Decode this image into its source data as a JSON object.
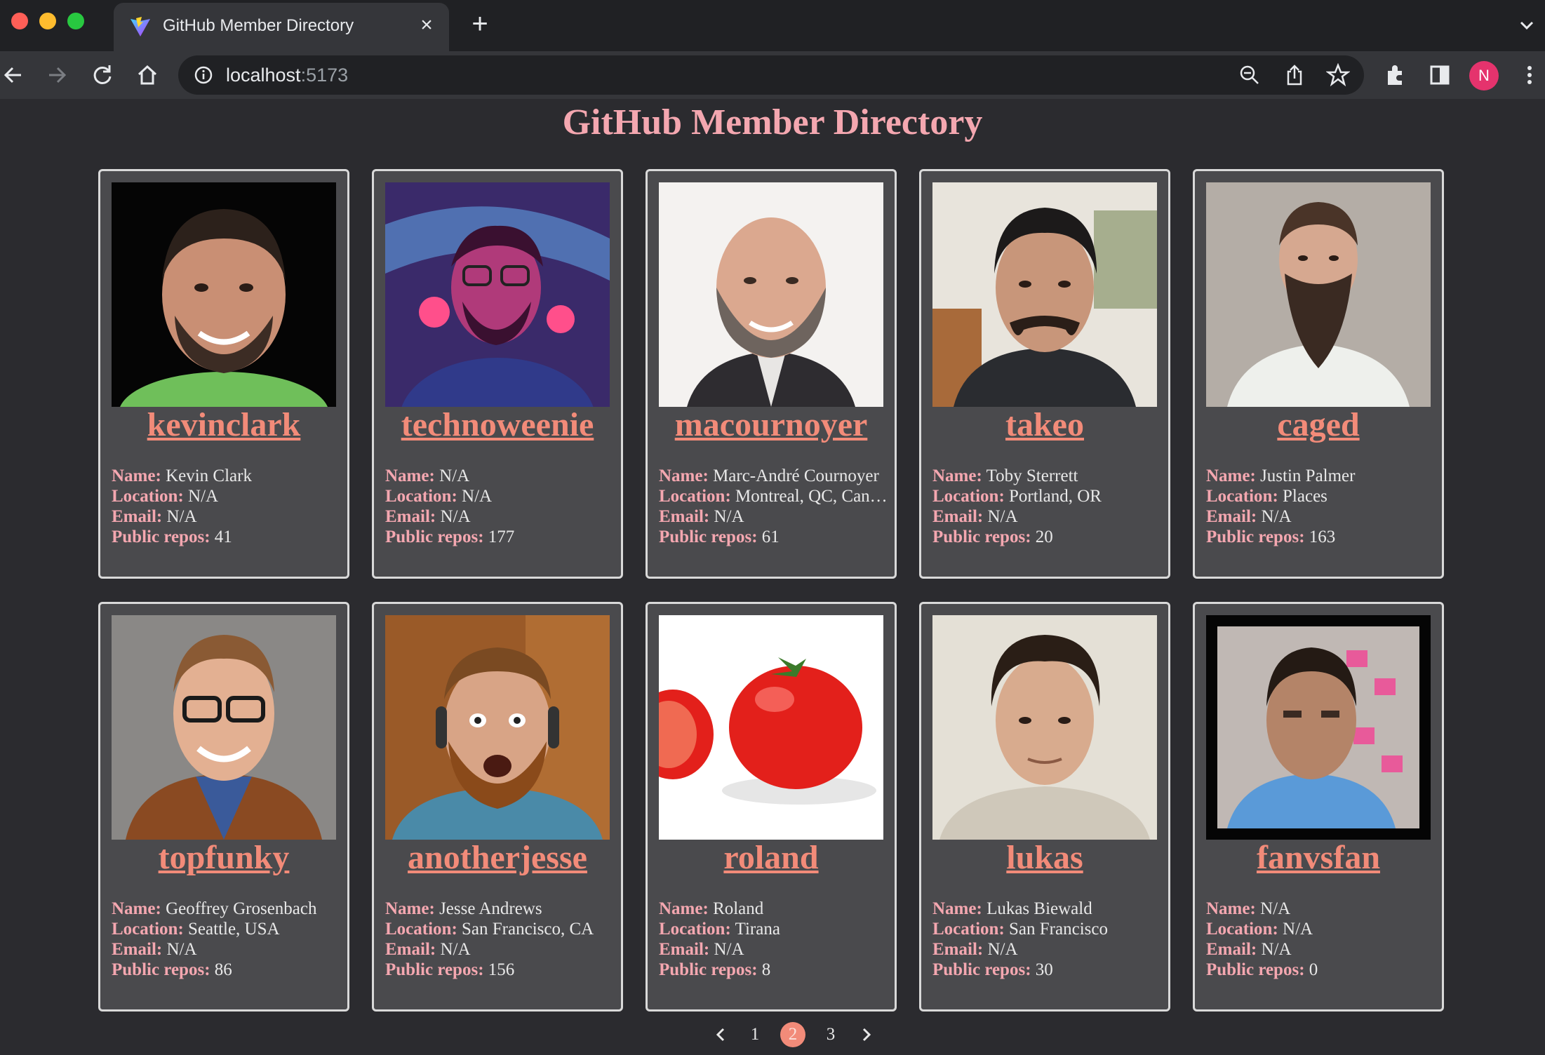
{
  "browser": {
    "tab_title": "GitHub Member Directory",
    "url_host": "localhost",
    "url_port": ":5173",
    "profile_initial": "N",
    "icons": [
      "vite-logo-icon",
      "close-icon",
      "plus-icon",
      "chevron-down-icon",
      "back-icon",
      "forward-icon",
      "reload-icon",
      "home-icon",
      "info-icon",
      "zoom-icon",
      "share-icon",
      "star-icon",
      "extensions-icon",
      "sidepanel-icon",
      "menu-icon"
    ]
  },
  "page": {
    "title": "GitHub Member Directory"
  },
  "labels": {
    "name": "Name:",
    "location": "Location:",
    "email": "Email:",
    "repos": "Public repos:"
  },
  "members": [
    {
      "login": "kevinclark",
      "name": "Kevin Clark",
      "location": "N/A",
      "email": "N/A",
      "repos": "41"
    },
    {
      "login": "technoweenie",
      "name": "N/A",
      "location": "N/A",
      "email": "N/A",
      "repos": "177"
    },
    {
      "login": "macournoyer",
      "name": "Marc-André Cournoyer",
      "location": "Montreal, QC, Canada",
      "email": "N/A",
      "repos": "61"
    },
    {
      "login": "takeo",
      "name": "Toby Sterrett",
      "location": "Portland, OR",
      "email": "N/A",
      "repos": "20"
    },
    {
      "login": "caged",
      "name": "Justin Palmer",
      "location": "Places",
      "email": "N/A",
      "repos": "163"
    },
    {
      "login": "topfunky",
      "name": "Geoffrey Grosenbach",
      "location": "Seattle, USA",
      "email": "N/A",
      "repos": "86"
    },
    {
      "login": "anotherjesse",
      "name": "Jesse Andrews",
      "location": "San Francisco, CA",
      "email": "N/A",
      "repos": "156"
    },
    {
      "login": "roland",
      "name": "Roland",
      "location": "Tirana",
      "email": "N/A",
      "repos": "8"
    },
    {
      "login": "lukas",
      "name": "Lukas Biewald",
      "location": "San Francisco",
      "email": "N/A",
      "repos": "30"
    },
    {
      "login": "fanvsfan",
      "name": "N/A",
      "location": "N/A",
      "email": "N/A",
      "repos": "0"
    }
  ],
  "pagination": {
    "pages": [
      "1",
      "2",
      "3"
    ],
    "current": "2"
  },
  "colors": {
    "accent": "#f28b79",
    "label": "#f4a7b0",
    "card_bg": "#4a4a4d",
    "page_bg": "#2b2b2f"
  }
}
